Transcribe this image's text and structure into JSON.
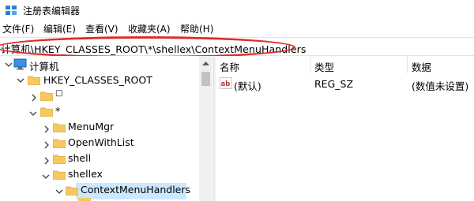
{
  "window": {
    "title": "注册表编辑器"
  },
  "menu": [
    "文件(F)",
    "编辑(E)",
    "查看(V)",
    "收藏夹(A)",
    "帮助(H)"
  ],
  "address": {
    "path": "计算机\\HKEY_CLASSES_ROOT\\*\\shellex\\ContextMenuHandlers"
  },
  "tree": {
    "root": "计算机",
    "hive": "HKEY_CLASSES_ROOT",
    "blank_key": "□",
    "star_key": "*",
    "menumgr": "MenuMgr",
    "openwithlist": "OpenWithList",
    "shell": "shell",
    "shellex": "shellex",
    "selected": "ContextMenuHandlers"
  },
  "list": {
    "headers": {
      "name": "名称",
      "type": "类型",
      "data": "数据"
    },
    "rows": [
      {
        "name": "(默认)",
        "type": "REG_SZ",
        "data": "(数值未设置)"
      }
    ]
  },
  "colors": {
    "highlight_oval": "#e02b2b",
    "selection": "#cce8ff",
    "folder": "#f6c85f"
  }
}
